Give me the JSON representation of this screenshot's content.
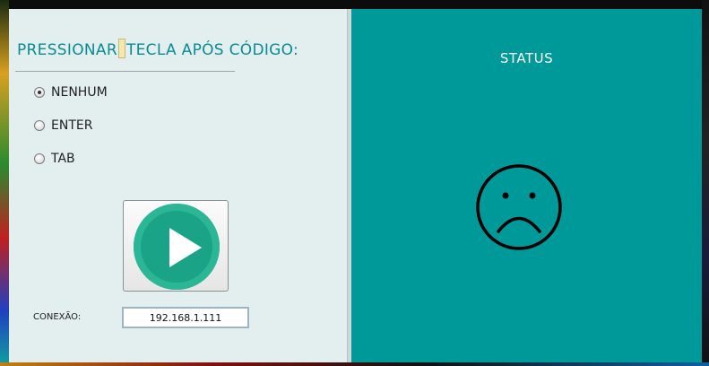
{
  "config_panel": {
    "heading_before_caret": "PRESSIONAR",
    "heading_after_caret": "TECLA APÓS CÓDIGO:",
    "key_options": [
      {
        "label": "NENHUM",
        "selected": true
      },
      {
        "label": "ENTER",
        "selected": false
      },
      {
        "label": "TAB",
        "selected": false
      }
    ],
    "connection_label": "CONEXÃO:",
    "connection_value": "192.168.1.111"
  },
  "status_panel": {
    "title": "STATUS",
    "face_icon": "sad-face-icon"
  },
  "colors": {
    "status_background": "#009999",
    "heading_color": "#0a8c93",
    "play_button_color": "#1aa387"
  }
}
